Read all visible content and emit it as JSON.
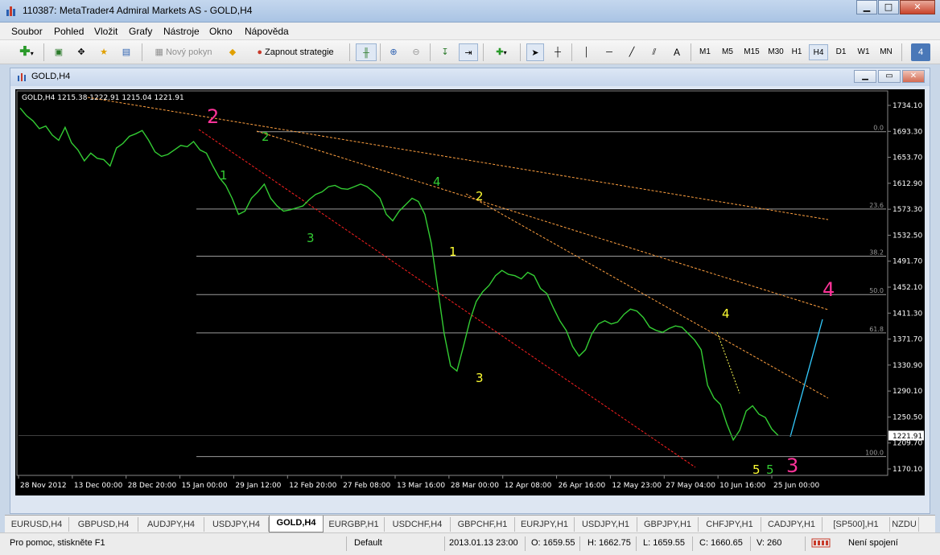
{
  "window": {
    "title": "110387: MetaTrader4 Admiral Markets AS - GOLD,H4"
  },
  "menu": [
    "Soubor",
    "Pohled",
    "Vložit",
    "Grafy",
    "Nástroje",
    "Okno",
    "Nápověda"
  ],
  "toolbar": {
    "new_order": "Nový pokyn",
    "autotrading": "Zapnout strategie",
    "text_tool": "A",
    "timeframes": [
      "M1",
      "M5",
      "M15",
      "M30",
      "H1",
      "H4",
      "D1",
      "W1",
      "MN"
    ],
    "active_timeframe": "H4"
  },
  "chart_window": {
    "title": "GOLD,H4",
    "info": "GOLD,H4  1215.38 1222.91 1215.04 1221.91"
  },
  "chart_data": {
    "type": "line",
    "symbol": "GOLD",
    "timeframe": "H4",
    "ohlc": {
      "open": 1215.38,
      "high": 1222.91,
      "low": 1215.04,
      "close": 1221.91
    },
    "y_ticks": [
      "1734.10",
      "1693.30",
      "1653.70",
      "1612.90",
      "1573.30",
      "1532.50",
      "1491.70",
      "1452.10",
      "1411.30",
      "1371.70",
      "1330.90",
      "1290.10",
      "1250.50",
      "1209.70",
      "1170.10"
    ],
    "current_price_label": "1221.91",
    "ylim": [
      1170.1,
      1734.1
    ],
    "x_ticks": [
      "28 Nov 2012",
      "13 Dec 00:00",
      "28 Dec 20:00",
      "15 Jan 00:00",
      "29 Jan 12:00",
      "12 Feb 20:00",
      "27 Feb 08:00",
      "13 Mar 16:00",
      "28 Mar 00:00",
      "12 Apr 08:00",
      "26 Apr 16:00",
      "12 May 23:00",
      "27 May 04:00",
      "10 Jun 16:00",
      "25 Jun 00:00"
    ],
    "fib_levels": [
      {
        "label": "0.0",
        "price": 1693.3
      },
      {
        "label": "23.6",
        "price": 1573.3
      },
      {
        "label": "38.2",
        "price": 1500.1
      },
      {
        "label": "50.0",
        "price": 1440.6
      },
      {
        "label": "61.8",
        "price": 1381.2
      },
      {
        "label": "100.0",
        "price": 1189.3
      }
    ],
    "price_series": [
      1730,
      1718,
      1710,
      1698,
      1702,
      1688,
      1680,
      1700,
      1676,
      1665,
      1648,
      1660,
      1652,
      1650,
      1640,
      1668,
      1675,
      1686,
      1690,
      1695,
      1680,
      1662,
      1655,
      1658,
      1665,
      1672,
      1670,
      1678,
      1665,
      1660,
      1640,
      1622,
      1610,
      1590,
      1565,
      1570,
      1590,
      1600,
      1612,
      1590,
      1578,
      1570,
      1572,
      1575,
      1578,
      1588,
      1596,
      1600,
      1608,
      1610,
      1605,
      1604,
      1608,
      1612,
      1608,
      1600,
      1590,
      1565,
      1555,
      1570,
      1580,
      1590,
      1585,
      1565,
      1520,
      1450,
      1380,
      1330,
      1322,
      1360,
      1400,
      1430,
      1445,
      1455,
      1470,
      1478,
      1472,
      1470,
      1465,
      1475,
      1470,
      1450,
      1442,
      1420,
      1400,
      1385,
      1360,
      1345,
      1355,
      1380,
      1395,
      1400,
      1395,
      1398,
      1410,
      1418,
      1415,
      1405,
      1390,
      1385,
      1382,
      1388,
      1392,
      1390,
      1380,
      1370,
      1355,
      1300,
      1280,
      1270,
      1240,
      1215,
      1230,
      1260,
      1268,
      1255,
      1250,
      1232,
      1221.91
    ],
    "wave_labels": [
      {
        "text": "2",
        "color": "#ff3399",
        "big": true
      },
      {
        "text": "2",
        "color": "#33cc33"
      },
      {
        "text": "1",
        "color": "#33cc33"
      },
      {
        "text": "3",
        "color": "#33cc33"
      },
      {
        "text": "4",
        "color": "#33cc33"
      },
      {
        "text": "2",
        "color": "#ffff33"
      },
      {
        "text": "1",
        "color": "#ffff33"
      },
      {
        "text": "3",
        "color": "#ffff33"
      },
      {
        "text": "4",
        "color": "#ffff33"
      },
      {
        "text": "5",
        "color": "#ffff33"
      },
      {
        "text": "5",
        "color": "#33cc33"
      },
      {
        "text": "3",
        "color": "#ff3399",
        "big": true
      },
      {
        "text": "4",
        "color": "#ff3399",
        "big": true
      }
    ]
  },
  "tabs": [
    "EURUSD,H4",
    "GBPUSD,H4",
    "AUDJPY,H4",
    "USDJPY,H4",
    "GOLD,H4",
    "EURGBP,H1",
    "USDCHF,H4",
    "GBPCHF,H1",
    "EURJPY,H1",
    "USDJPY,H1",
    "GBPJPY,H1",
    "CHFJPY,H1",
    "CADJPY,H1",
    "[SP500],H1",
    "NZDU"
  ],
  "active_tab": "GOLD,H4",
  "status": {
    "help": "Pro pomoc, stiskněte F1",
    "profile": "Default",
    "datetime": "2013.01.13 23:00",
    "open": "O: 1659.55",
    "high": "H: 1662.75",
    "low": "L: 1659.55",
    "close": "C: 1660.65",
    "volume": "V: 260",
    "connection": "Není spojení"
  }
}
